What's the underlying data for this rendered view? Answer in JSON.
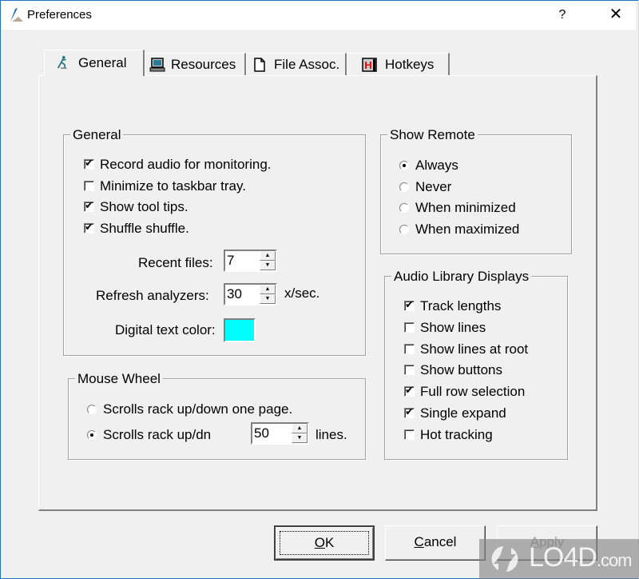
{
  "window": {
    "title": "Preferences",
    "help_label": "?",
    "close_label": "✕"
  },
  "tabs": [
    {
      "label": "General",
      "icon": "runner-icon",
      "active": true
    },
    {
      "label": "Resources",
      "icon": "computer-icon",
      "active": false
    },
    {
      "label": "File Assoc.",
      "icon": "document-icon",
      "active": false
    },
    {
      "label": "Hotkeys",
      "icon": "hotkey-h-icon",
      "active": false
    }
  ],
  "general_group": {
    "legend": "General",
    "checkboxes": [
      {
        "label": "Record audio for monitoring.",
        "checked": true
      },
      {
        "label": "Minimize to taskbar tray.",
        "checked": false
      },
      {
        "label": "Show tool tips.",
        "checked": true
      },
      {
        "label": "Shuffle shuffle.",
        "checked": true
      }
    ],
    "recent_files": {
      "label": "Recent files:",
      "value": "7"
    },
    "refresh_analyzers": {
      "label": "Refresh analyzers:",
      "value": "30",
      "unit": "x/sec."
    },
    "digital_text_color": {
      "label": "Digital text color:",
      "color": "#00ffff"
    }
  },
  "mouse_wheel_group": {
    "legend": "Mouse Wheel",
    "options": [
      {
        "label": "Scrolls rack up/down one page.",
        "selected": false
      },
      {
        "label": "Scrolls rack up/dn",
        "selected": true
      }
    ],
    "lines": {
      "value": "50",
      "unit": "lines."
    }
  },
  "show_remote_group": {
    "legend": "Show Remote",
    "options": [
      {
        "label": "Always",
        "selected": true
      },
      {
        "label": "Never",
        "selected": false
      },
      {
        "label": "When minimized",
        "selected": false
      },
      {
        "label": "When maximized",
        "selected": false
      }
    ]
  },
  "audio_library_group": {
    "legend": "Audio Library Displays",
    "checkboxes": [
      {
        "label": "Track lengths",
        "checked": true
      },
      {
        "label": "Show lines",
        "checked": false
      },
      {
        "label": "Show lines at root",
        "checked": false
      },
      {
        "label": "Show buttons",
        "checked": false
      },
      {
        "label": "Full row selection",
        "checked": true
      },
      {
        "label": "Single expand",
        "checked": true
      },
      {
        "label": "Hot tracking",
        "checked": false
      }
    ]
  },
  "buttons": {
    "ok": {
      "label_underlined": "O",
      "label_rest": "K"
    },
    "cancel": {
      "label_underlined": "C",
      "label_rest": "ancel"
    },
    "apply": {
      "label_underlined": "A",
      "label_rest": "pply",
      "disabled": true
    }
  },
  "watermark": {
    "text": "LO4D",
    "suffix": ".com"
  },
  "spin_glyphs": {
    "up": "▲",
    "down": "▼"
  },
  "check_glyph": "✔"
}
